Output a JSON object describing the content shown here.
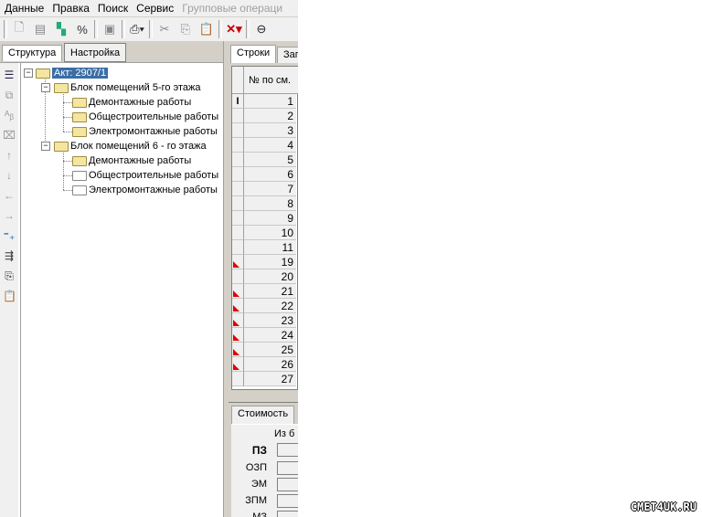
{
  "menu": [
    "Данные",
    "Правка",
    "Поиск",
    "Сервис",
    "Групповые операци"
  ],
  "toolbar": {
    "icons": [
      "new-doc-icon",
      "open-icon",
      "tree-structure-icon",
      "percent-icon",
      "save-icon",
      "print-icon",
      "cut-icon",
      "copy-icon",
      "paste-icon",
      "delete-icon",
      "link-icon"
    ]
  },
  "left_tabs": [
    "Структура",
    "Настройка"
  ],
  "tree": {
    "root": "Акт: 2907/1",
    "blocks": [
      {
        "label": "Блок помещений 5-го этажа",
        "children": [
          "Демонтажные работы",
          "Общестроительные работы",
          "Электромонтажные работы"
        ]
      },
      {
        "label": "Блок помещений 6 - го этажа",
        "children": [
          "Демонтажные работы",
          "Общестроительные работы",
          "Электромонтажные работы"
        ]
      }
    ]
  },
  "right_tabs": [
    "Строки",
    "Заг"
  ],
  "grid": {
    "header": "№ по см.",
    "rows": [
      {
        "n": "1",
        "flag": false
      },
      {
        "n": "2",
        "flag": false
      },
      {
        "n": "3",
        "flag": false
      },
      {
        "n": "4",
        "flag": false
      },
      {
        "n": "5",
        "flag": false
      },
      {
        "n": "6",
        "flag": false
      },
      {
        "n": "7",
        "flag": false
      },
      {
        "n": "8",
        "flag": false
      },
      {
        "n": "9",
        "flag": false
      },
      {
        "n": "10",
        "flag": false
      },
      {
        "n": "11",
        "flag": false
      },
      {
        "n": "19",
        "flag": true
      },
      {
        "n": "20",
        "flag": false
      },
      {
        "n": "21",
        "flag": true
      },
      {
        "n": "22",
        "flag": true
      },
      {
        "n": "23",
        "flag": true
      },
      {
        "n": "24",
        "flag": true
      },
      {
        "n": "25",
        "flag": true
      },
      {
        "n": "26",
        "flag": true
      },
      {
        "n": "27",
        "flag": false
      }
    ]
  },
  "cost": {
    "tab": "Стоимость",
    "column": "Из б",
    "rows": [
      "ПЗ",
      "ОЗП",
      "ЭМ",
      "ЗПМ",
      "МЗ"
    ]
  },
  "watermark": "СМЕТ4UK.RU"
}
